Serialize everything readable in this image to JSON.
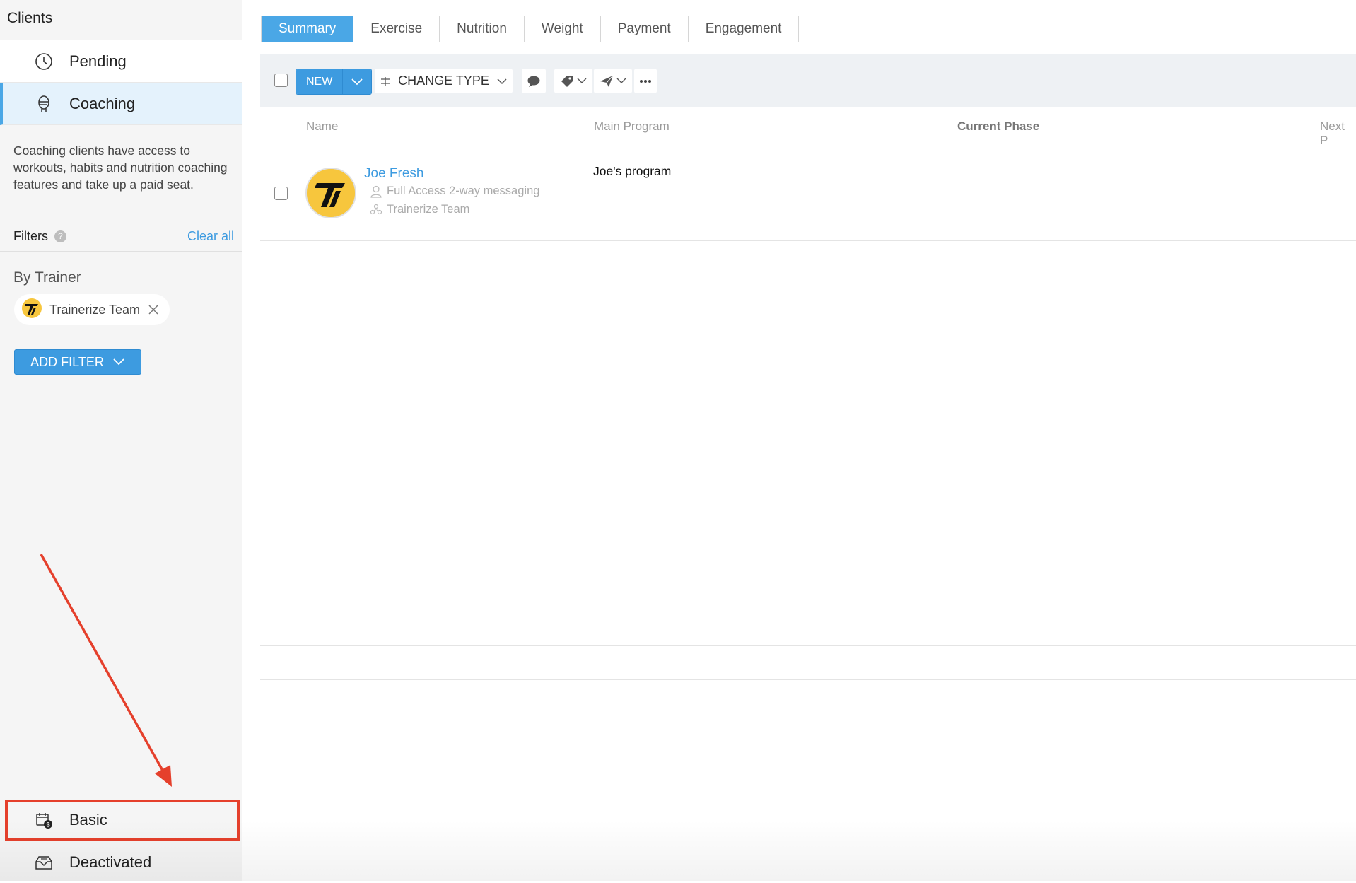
{
  "sidebar": {
    "title": "Clients",
    "items": [
      {
        "label": "Pending",
        "icon": "clock-icon"
      },
      {
        "label": "Coaching",
        "icon": "coach-icon",
        "active": true
      }
    ],
    "description": "Coaching clients have access to workouts, habits and nutrition coaching features and take up a paid seat.",
    "filters_label": "Filters",
    "clear_all": "Clear all",
    "by_trainer": "By Trainer",
    "trainer_chip": "Trainerize Team",
    "add_filter": "ADD FILTER",
    "bottom_items": [
      {
        "label": "Basic",
        "icon": "calendar-dollar-icon"
      },
      {
        "label": "Deactivated",
        "icon": "inbox-icon"
      }
    ],
    "highlight_color": "#e5402c"
  },
  "tabs": [
    "Summary",
    "Exercise",
    "Nutrition",
    "Weight",
    "Payment",
    "Engagement"
  ],
  "toolbar": {
    "new_label": "NEW",
    "change_type": "CHANGE TYPE"
  },
  "table": {
    "columns": [
      "Name",
      "Main Program",
      "Current Phase",
      "Next P"
    ],
    "rows": [
      {
        "name": "Joe Fresh",
        "access": "Full Access 2-way messaging",
        "team": "Trainerize Team",
        "program": "Joe's program"
      }
    ]
  },
  "colors": {
    "accent": "#3d9be0",
    "active_tab": "#4aa7e6",
    "avatar_bg": "#f7c63d"
  }
}
